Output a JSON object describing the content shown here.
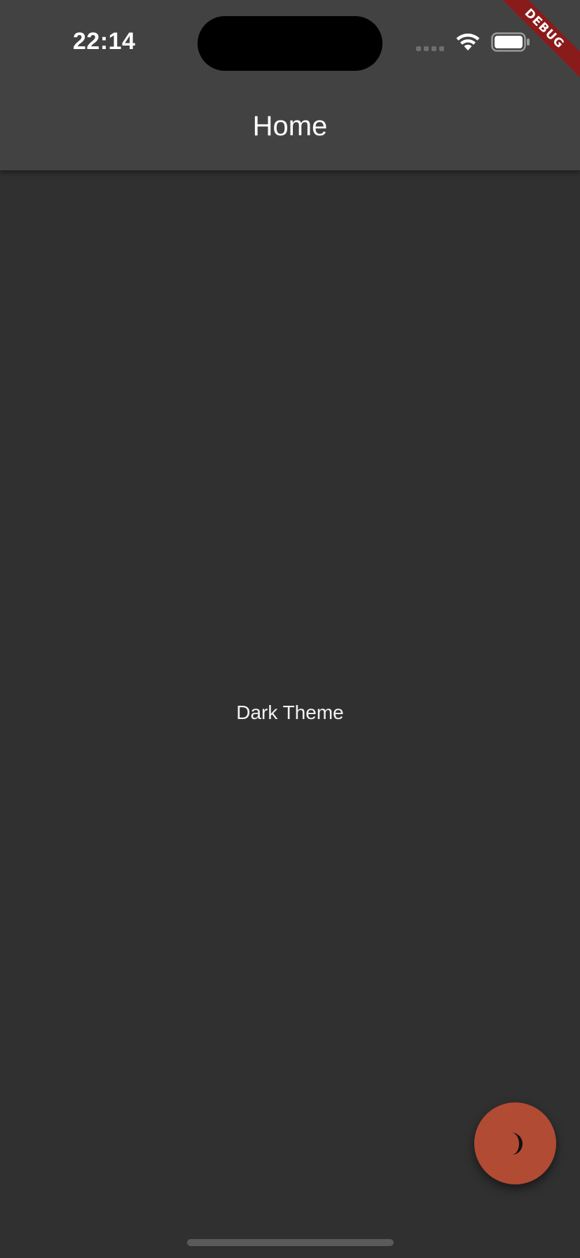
{
  "status_bar": {
    "time": "22:14"
  },
  "debug_banner": {
    "label": "DEBUG"
  },
  "app_bar": {
    "title": "Home"
  },
  "body": {
    "theme_label": "Dark Theme"
  },
  "fab": {
    "icon": "moon-icon"
  },
  "colors": {
    "background": "#303030",
    "app_bar": "#424242",
    "fab": "#b24b33",
    "debug_banner": "#8a1b1b"
  }
}
